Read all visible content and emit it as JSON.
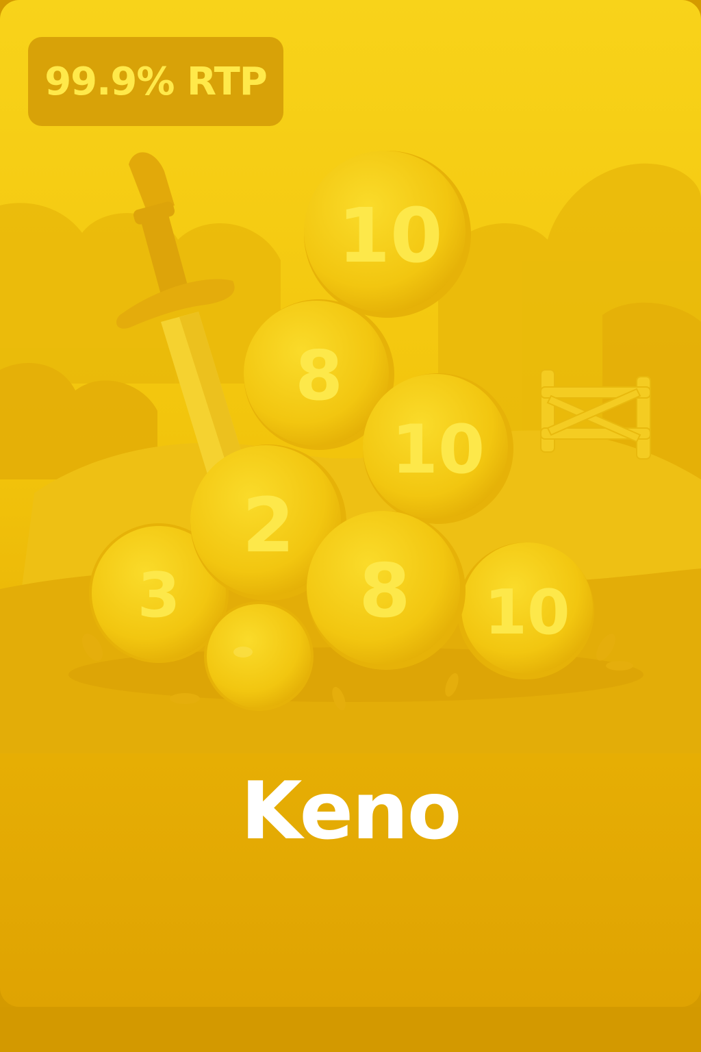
{
  "card": {
    "rtp_badge": "99.9% RTP",
    "title": "Keno"
  },
  "balls": [
    {
      "number": "10"
    },
    {
      "number": "8"
    },
    {
      "number": "10"
    },
    {
      "number": "2"
    },
    {
      "number": "3"
    },
    {
      "number": "8"
    },
    {
      "number": "10"
    },
    {
      "number": ""
    }
  ],
  "colors": {
    "card_top": "#f8d31a",
    "card_bottom": "#dfa302",
    "badge_bg": "#d8a208",
    "badge_text": "#ffe94a",
    "title_text": "#ffffff",
    "ball_fill": "#f5cc14",
    "ball_number": "#fff04f"
  }
}
